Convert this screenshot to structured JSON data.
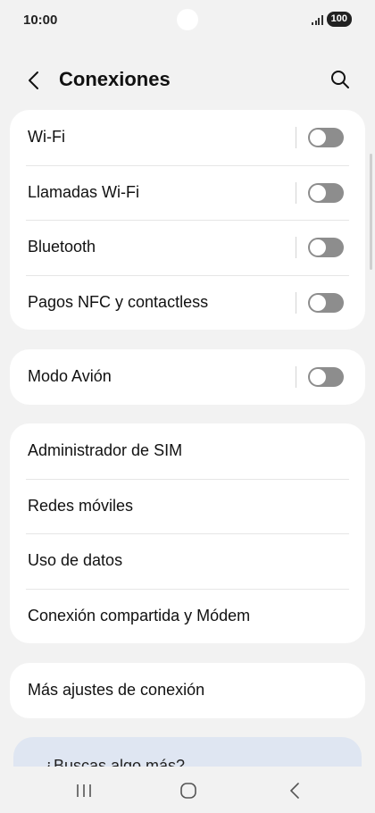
{
  "status_bar": {
    "time": "10:00",
    "battery": "100"
  },
  "header": {
    "title": "Conexiones",
    "back_icon": "chevron-left-icon",
    "search_icon": "search-icon"
  },
  "groups": [
    {
      "items": [
        {
          "label": "Wi-Fi",
          "toggle": false
        },
        {
          "label": "Llamadas Wi-Fi",
          "toggle": false
        },
        {
          "label": "Bluetooth",
          "toggle": false
        },
        {
          "label": "Pagos NFC y contactless",
          "toggle": false
        }
      ]
    },
    {
      "items": [
        {
          "label": "Modo Avión",
          "toggle": false
        }
      ]
    },
    {
      "items": [
        {
          "label": "Administrador de SIM"
        },
        {
          "label": "Redes móviles"
        },
        {
          "label": "Uso de datos"
        },
        {
          "label": "Conexión compartida y Módem"
        }
      ]
    },
    {
      "items": [
        {
          "label": "Más ajustes de conexión"
        }
      ]
    }
  ],
  "promo": {
    "text": "¿Buscas algo más?"
  },
  "colors": {
    "background": "#f2f2f2",
    "card": "#ffffff",
    "toggle_off": "#8d8d8d",
    "promo": "#dfe6f2"
  }
}
